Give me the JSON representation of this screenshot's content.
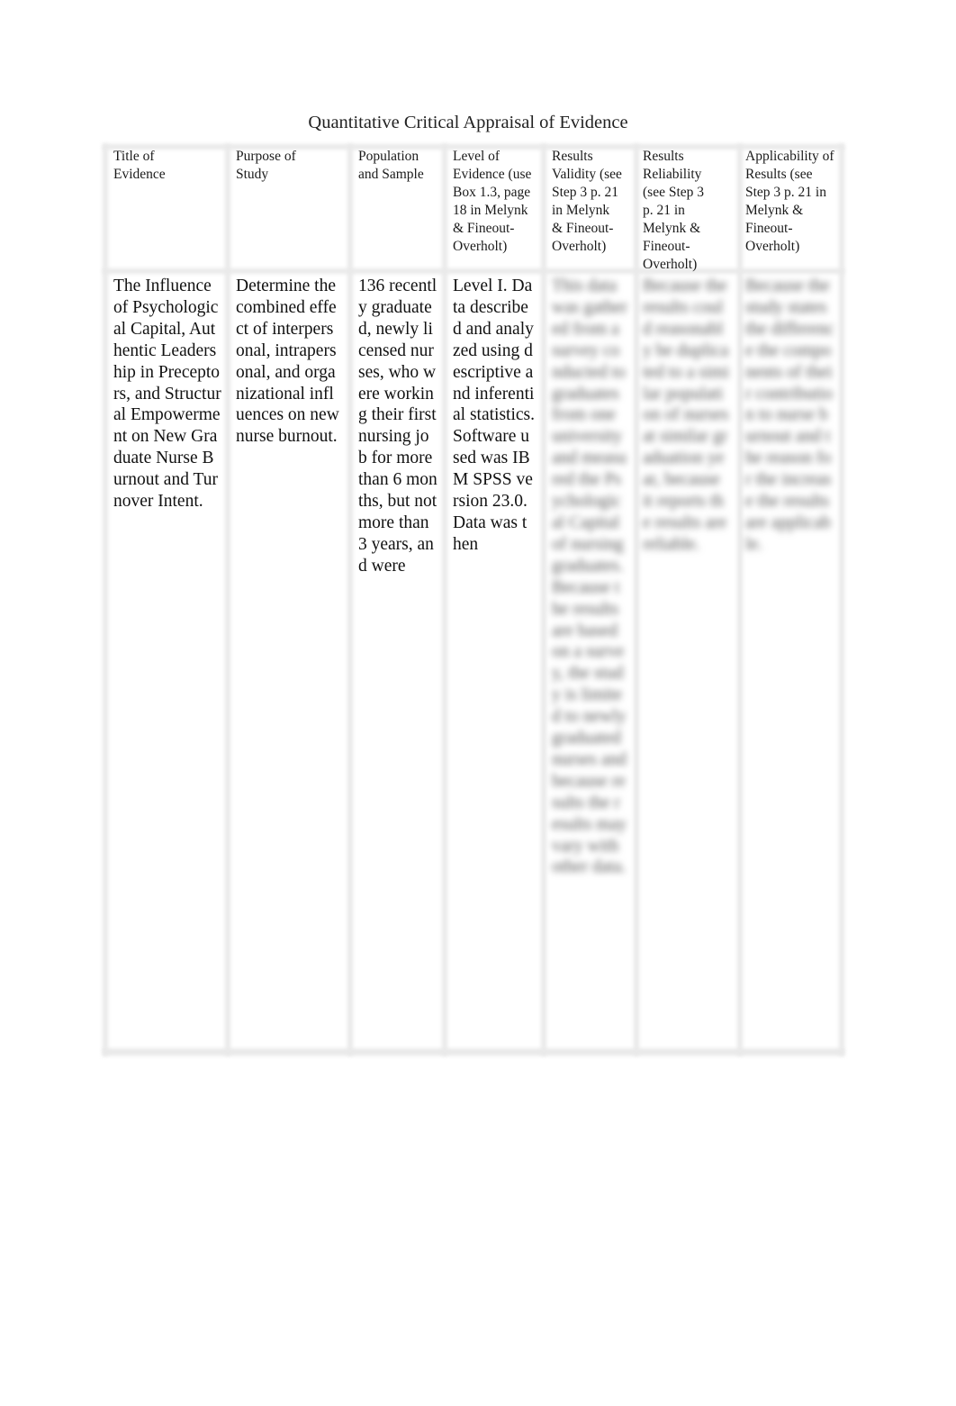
{
  "document": {
    "title": "Quantitative Critical Appraisal of Evidence"
  },
  "table": {
    "headers": [
      "Title of Evidence",
      "Purpose of Study",
      "Population and Sample",
      "Level of Evidence (use Box 1.3, page 18 in Melynk & Fineout-Overholt)",
      "Results Validity (see Step 3 p. 21 in Melynk & Fineout-Overholt)",
      "Results Reliability (see Step 3 p. 21 in Melynk & Fineout-Overholt)",
      "Applicability of Results (see Step 3 p. 21 in Melynk & Fineout-Overholt)"
    ],
    "rows": [
      {
        "title_of_evidence": "The Influence of Psychological Capital, Authentic Leadership in Preceptors, and Structural Empowerment on New Graduate Nurse Burnout and Turnover Intent.",
        "purpose_of_study": "Determine the combined effect of interpersonal, intrapersonal, and organizational influences on new nurse burnout.",
        "population_and_sample": "136 recently graduated, newly licensed nurses, who were working their first nursing job for more than 6 months, but not more than 3 years, and were",
        "level_of_evidence": "Level I. Data described and analyzed using descriptive and inferential statistics. Software used was IBM SPSS version 23.0. Data was then",
        "results_validity": "This data was gathered from a survey conducted to graduates from one university and measured the Psychological Capital of nursing graduates. Because the results are based on a survey, the study is limited to newly graduated nurses and because results the results may vary with other data.",
        "results_reliability": "Because the results could reasonably be duplicated to a similar population of nurses at similar graduation year, because it reports the results are reliable.",
        "applicability_of_results": "Because the study states the difference the components of their contribution to nurse burnout and the reason for the increase the results are applicable."
      }
    ]
  }
}
